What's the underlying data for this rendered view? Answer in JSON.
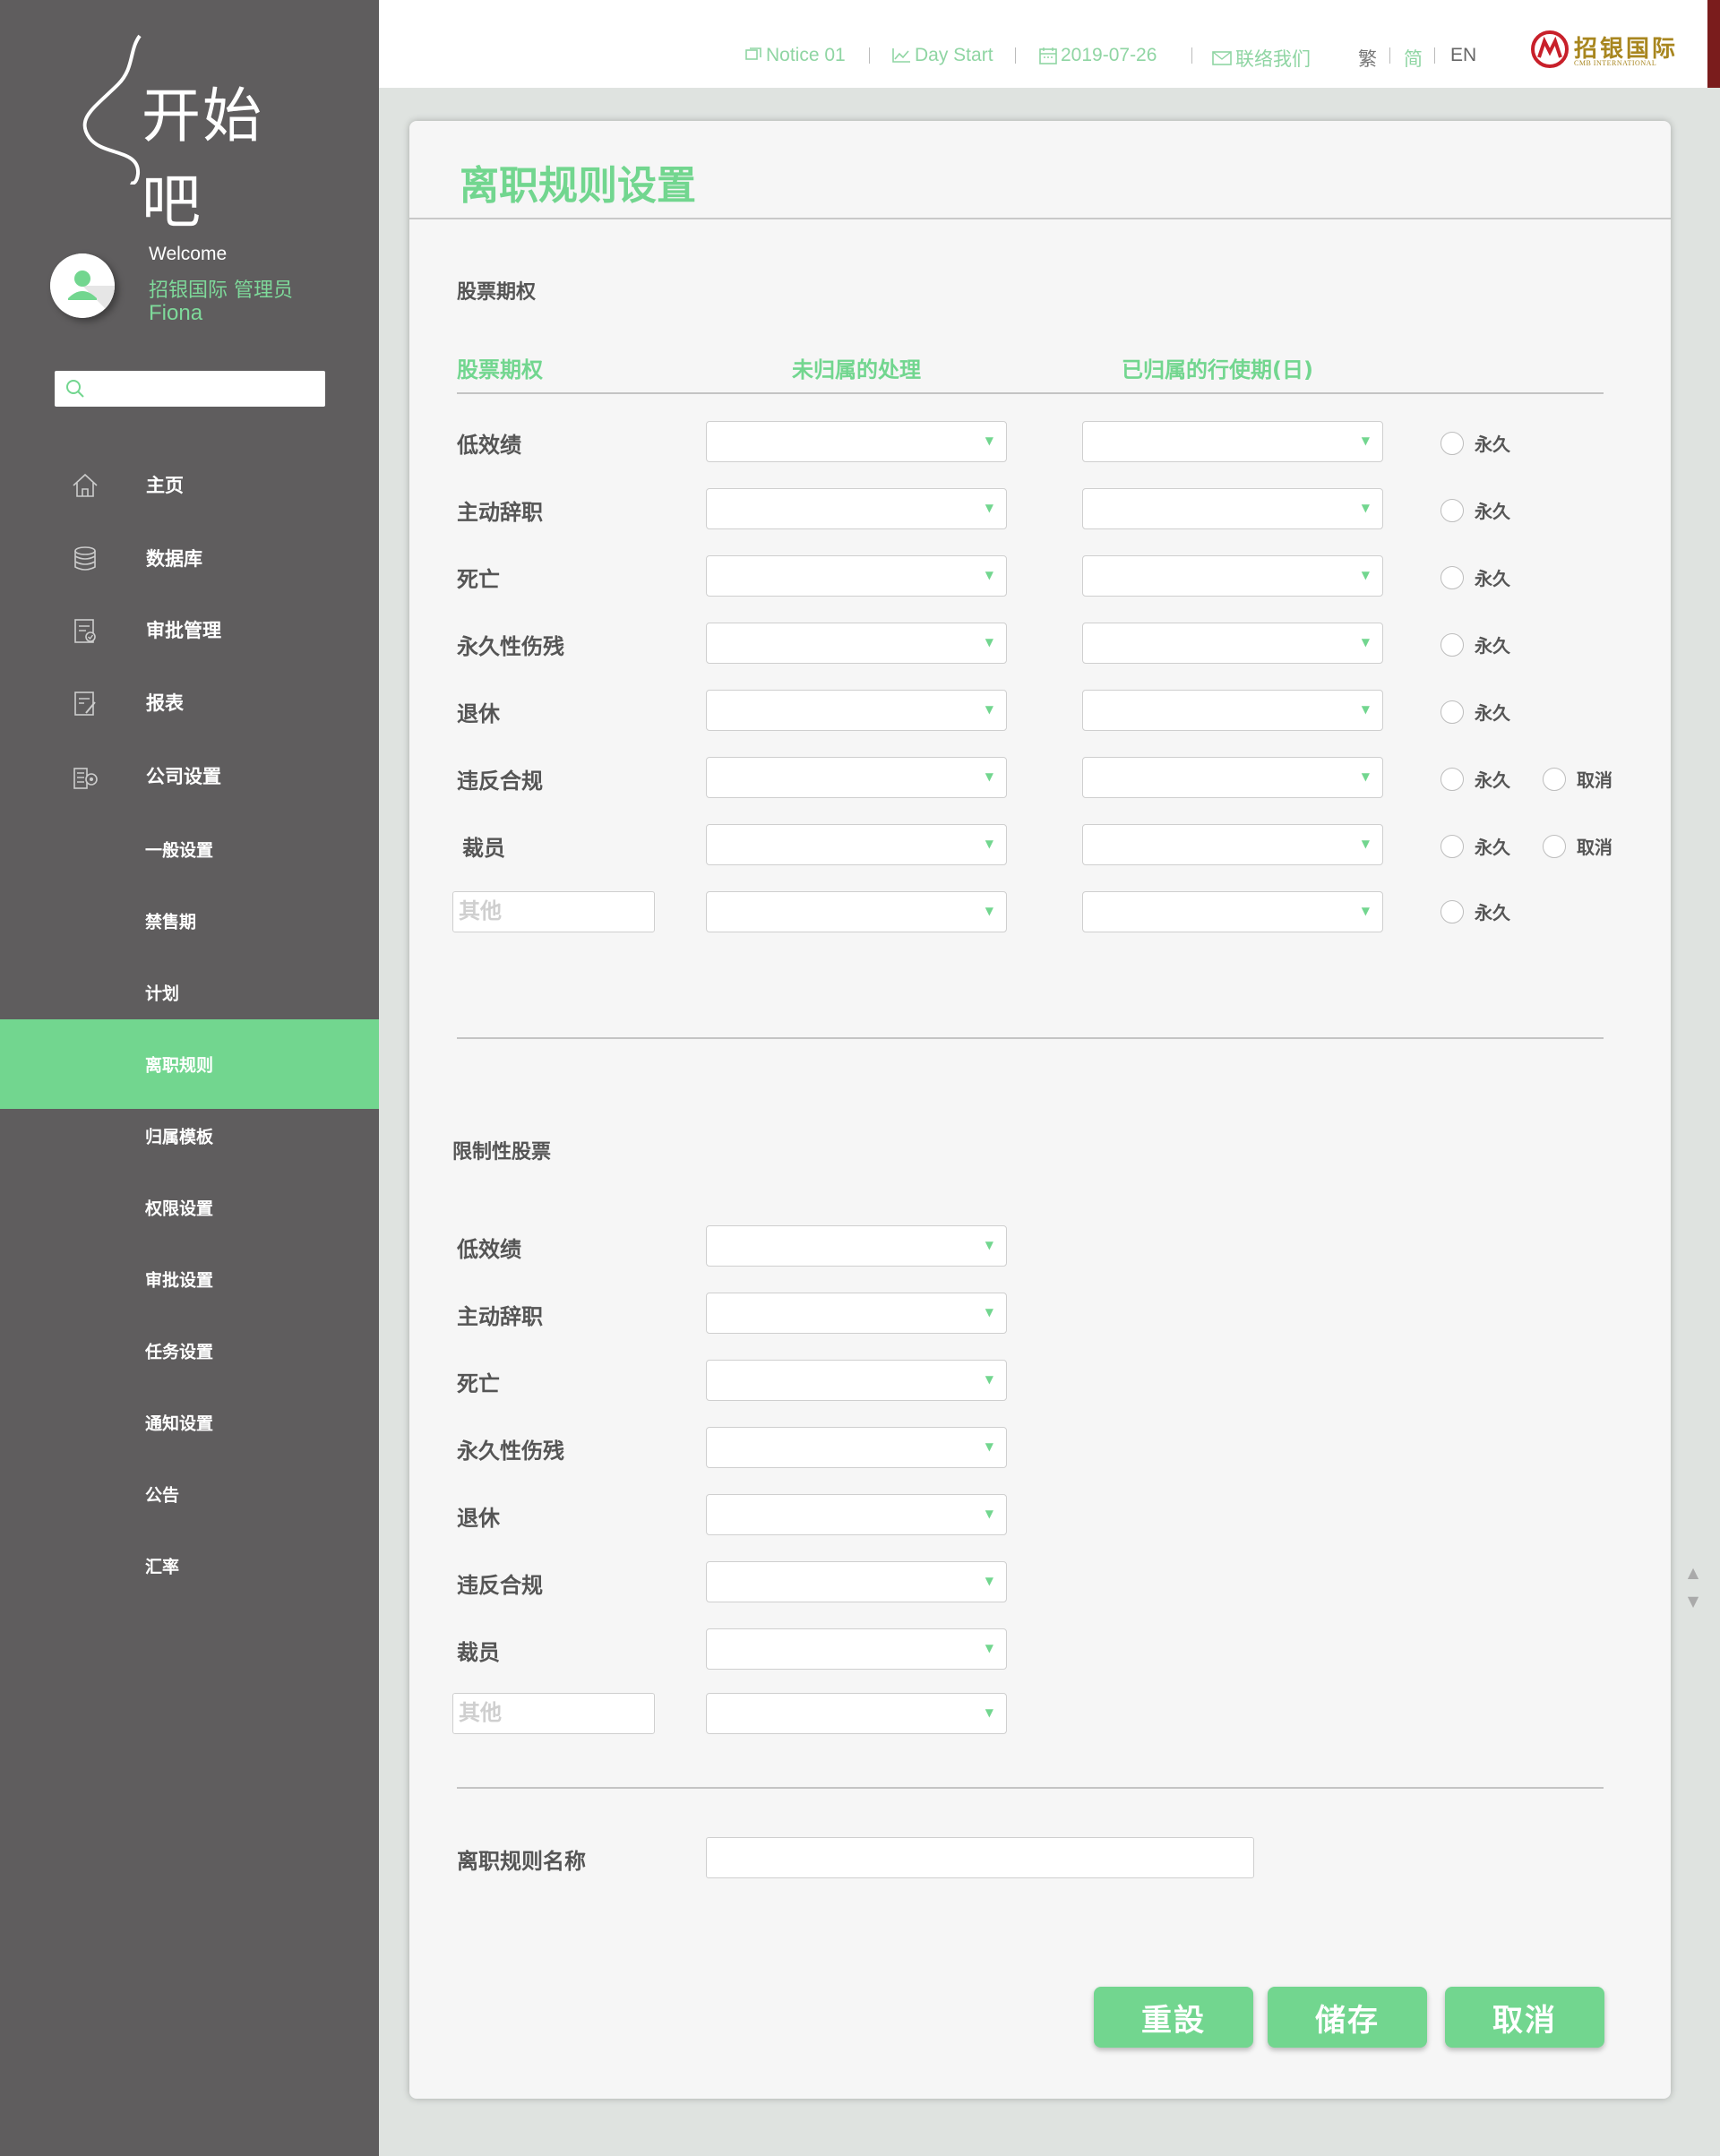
{
  "sidebar": {
    "logo_text": "开始吧",
    "welcome": "Welcome",
    "user_company": "招银国际 管理员",
    "user_name": "Fiona",
    "search_placeholder": "",
    "nav": [
      {
        "label": "主页",
        "icon": "home-icon"
      },
      {
        "label": "数据库",
        "icon": "database-icon"
      },
      {
        "label": "审批管理",
        "icon": "approval-icon"
      },
      {
        "label": "报表",
        "icon": "report-icon"
      },
      {
        "label": "公司设置",
        "icon": "company-settings-icon"
      }
    ],
    "sub_nav": [
      {
        "label": "一般设置"
      },
      {
        "label": "禁售期"
      },
      {
        "label": "计划"
      },
      {
        "label": "离职规则",
        "active": true
      },
      {
        "label": "归属模板"
      },
      {
        "label": "权限设置"
      },
      {
        "label": "审批设置"
      },
      {
        "label": "任务设置"
      },
      {
        "label": "通知设置"
      },
      {
        "label": "公告"
      },
      {
        "label": "汇率"
      }
    ]
  },
  "topbar": {
    "notice": "Notice 01",
    "day_start": "Day Start",
    "date": "2019-07-26",
    "contact": "联络我们",
    "lang_traditional": "繁",
    "lang_simplified": "简",
    "lang_english": "EN",
    "brand_cn": "招银国际",
    "brand_en": "CMB INTERNATIONAL"
  },
  "page": {
    "title": "离职规则设置",
    "options_section": {
      "title": "股票期权",
      "col_headers": [
        "股票期权",
        "未归属的处理",
        "已归属的行使期(日)"
      ],
      "rows": [
        {
          "label": "低效绩",
          "radios": [
            "永久"
          ]
        },
        {
          "label": "主动辞职",
          "radios": [
            "永久"
          ]
        },
        {
          "label": "死亡",
          "radios": [
            "永久"
          ]
        },
        {
          "label": "永久性伤残",
          "radios": [
            "永久"
          ]
        },
        {
          "label": "退休",
          "radios": [
            "永久"
          ]
        },
        {
          "label": "违反合规",
          "radios": [
            "永久",
            "取消"
          ]
        },
        {
          "label": "裁员",
          "radios": [
            "永久",
            "取消"
          ]
        }
      ],
      "other_placeholder": "其他",
      "other_radio": "永久"
    },
    "restricted_section": {
      "title": "限制性股票",
      "rows": [
        "低效绩",
        "主动辞职",
        "死亡",
        "永久性伤残",
        "退休",
        "违反合规",
        "裁员"
      ],
      "other_placeholder": "其他"
    },
    "rule_name_label": "离职规则名称",
    "buttons": {
      "reset": "重設",
      "save": "储存",
      "cancel": "取消"
    }
  },
  "colors": {
    "accent": "#72d68f",
    "sidebar_bg": "#5f5d5e",
    "brand_gold": "#a8861f",
    "brand_red": "#c8202a"
  }
}
